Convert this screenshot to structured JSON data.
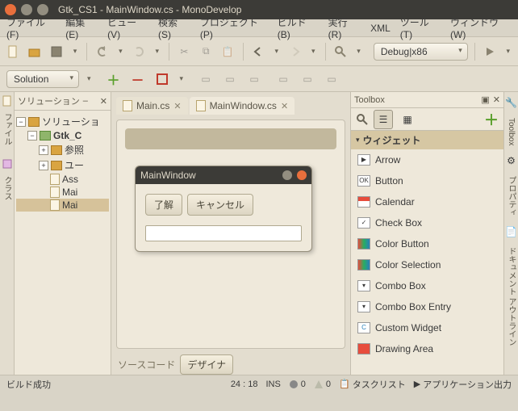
{
  "window": {
    "title": "Gtk_CS1 - MainWindow.cs - MonoDevelop"
  },
  "menubar": [
    "ファイル (F)",
    "編集 (E)",
    "ビュー (V)",
    "検索 (S)",
    "プロジェクト (P)",
    "ビルド (B)",
    "実行 (R)",
    "XML",
    "ツール (T)",
    "ウィンドウ (W)"
  ],
  "secondbar": {
    "solution_combo": "Solution",
    "config_combo": "Debug|x86"
  },
  "leftstrip": {
    "files": "ファイル",
    "classes": "クラス"
  },
  "solution": {
    "title": "ソリューション",
    "root": "ソリューショ",
    "project": "Gtk_C",
    "refs": "参照",
    "ui": "ユー",
    "asm": "Ass",
    "main": "Mai",
    "mainwin": "Mai"
  },
  "tabs": {
    "main": "Main.cs",
    "mainwin": "MainWindow.cs"
  },
  "dialog": {
    "title": "MainWindow",
    "ok": "了解",
    "cancel": "キャンセル"
  },
  "bottomtabs": {
    "source": "ソースコード",
    "designer": "デザイナ"
  },
  "toolbox": {
    "title": "Toolbox",
    "category": "ウィジェット",
    "items": [
      "Arrow",
      "Button",
      "Calendar",
      "Check Box",
      "Color Button",
      "Color Selection",
      "Combo Box",
      "Combo Box Entry",
      "Custom Widget",
      "Drawing Area"
    ]
  },
  "rightstrip": {
    "toolbox": "Toolbox",
    "properties": "プロパティ",
    "outline": "ドキュメント アウトライン"
  },
  "status": {
    "build": "ビルド成功",
    "pos": "24 : 18",
    "ins": "INS",
    "err": "0",
    "warn": "0",
    "tasklist": "タスクリスト",
    "appout": "アプリケーション出力"
  }
}
